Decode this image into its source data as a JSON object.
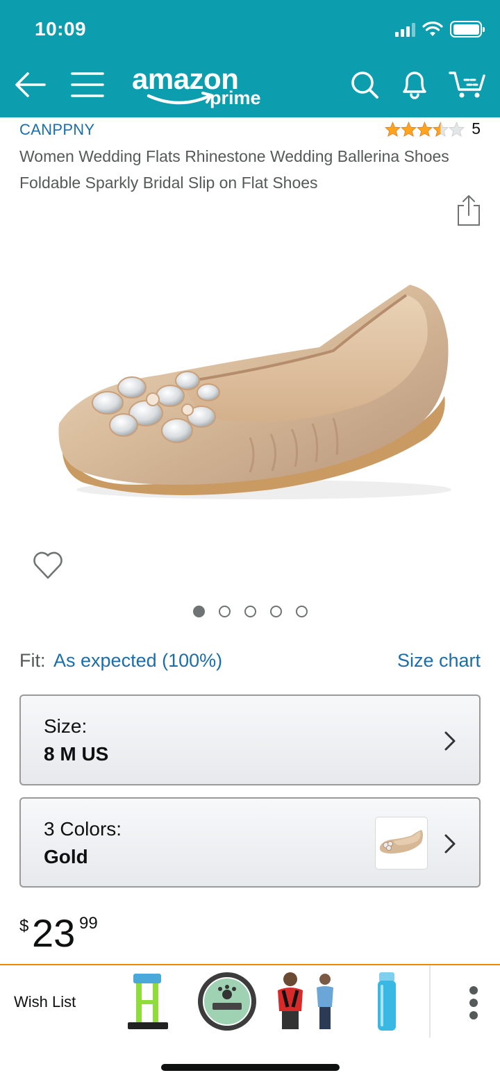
{
  "status_bar": {
    "time": "10:09"
  },
  "header": {
    "logo_text": "amazon",
    "logo_subtext": "prime",
    "colors": {
      "background": "#0c9eaf",
      "foreground": "#ffffff"
    }
  },
  "product": {
    "brand": "CANPPNY",
    "rating_stars": 3.5,
    "rating_count": "5",
    "title": "Women Wedding Flats Rhinestone Wedding Ballerina Shoes Foldable Sparkly Bridal Slip on Flat Shoes",
    "image_count": 5,
    "active_image_index": 0
  },
  "fit": {
    "label": "Fit:",
    "value": "As expected (100%)",
    "size_chart_link": "Size chart"
  },
  "size_selector": {
    "label": "Size:",
    "value": "8 M US"
  },
  "color_selector": {
    "label": "3 Colors:",
    "value": "Gold"
  },
  "price": {
    "symbol": "$",
    "whole": "23",
    "fraction": "99"
  },
  "bottom_strip": {
    "wish_list_label": "Wish List",
    "items": [
      "fitness-stand-thumbnail",
      "paw-nectar-balm-thumbnail",
      "posture-corrector-thumbnail",
      "water-bottle-thumbnail"
    ]
  },
  "colors": {
    "link": "#1a6eab",
    "star": "#ffa41c",
    "accent_border": "#f08804"
  }
}
